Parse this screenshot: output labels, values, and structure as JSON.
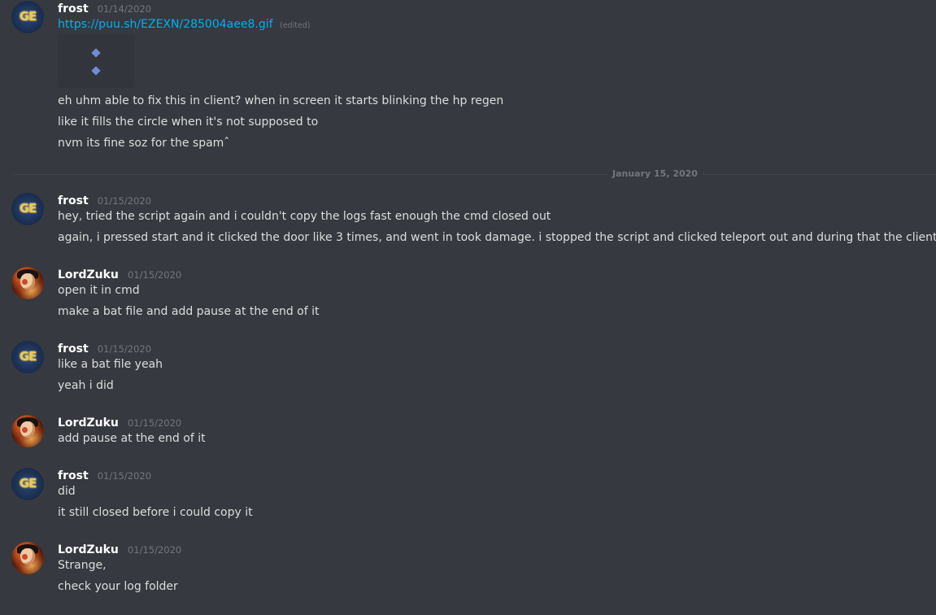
{
  "messages": [
    {
      "author": "frost",
      "timestamp": "01/14/2020",
      "link": "https://puu.sh/EZEXN/285004aee8.gif",
      "edited": "(edited)",
      "lines": [
        "eh uhm able to fix this in client? when in screen it starts blinking the hp regen",
        "like it fills the circle when it's not supposed to",
        "nvm its fine soz for the spamˆ"
      ]
    },
    {
      "divider": "January 15, 2020"
    },
    {
      "author": "frost",
      "timestamp": "01/15/2020",
      "lines": [
        "hey, tried the script again and i couldn't copy the logs fast enough the cmd closed out",
        "again, i pressed start and it clicked the door like 3 times, and went in took damage. i stopped the script and clicked teleport out and during that the client closed"
      ]
    },
    {
      "author": "LordZuku",
      "timestamp": "01/15/2020",
      "lines": [
        "open it in cmd",
        "make a bat file and add pause at the end of it"
      ]
    },
    {
      "author": "frost",
      "timestamp": "01/15/2020",
      "lines": [
        "like a bat file yeah",
        "yeah i did"
      ]
    },
    {
      "author": "LordZuku",
      "timestamp": "01/15/2020",
      "lines": [
        "add pause at the end of it"
      ]
    },
    {
      "author": "frost",
      "timestamp": "01/15/2020",
      "lines": [
        "did",
        "it still closed before i could copy it"
      ]
    },
    {
      "author": "LordZuku",
      "timestamp": "01/15/2020",
      "lines": [
        "Strange,",
        "check your log folder"
      ]
    }
  ],
  "avatar_text": {
    "frost": "GE"
  },
  "colors": {
    "background": "#36393f",
    "link": "#00b0f4",
    "username": "#ffffff",
    "timestamp": "#72767d",
    "text": "#dcddde",
    "embed_icon": "#7289da"
  }
}
